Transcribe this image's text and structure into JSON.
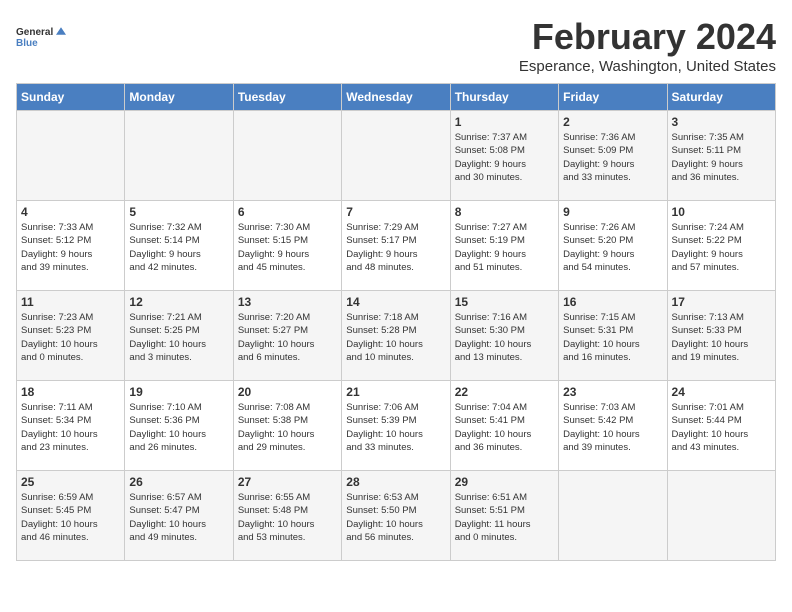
{
  "header": {
    "logo_line1": "General",
    "logo_line2": "Blue",
    "month": "February 2024",
    "location": "Esperance, Washington, United States"
  },
  "days_header": [
    "Sunday",
    "Monday",
    "Tuesday",
    "Wednesday",
    "Thursday",
    "Friday",
    "Saturday"
  ],
  "weeks": [
    [
      {
        "num": "",
        "info": ""
      },
      {
        "num": "",
        "info": ""
      },
      {
        "num": "",
        "info": ""
      },
      {
        "num": "",
        "info": ""
      },
      {
        "num": "1",
        "info": "Sunrise: 7:37 AM\nSunset: 5:08 PM\nDaylight: 9 hours\nand 30 minutes."
      },
      {
        "num": "2",
        "info": "Sunrise: 7:36 AM\nSunset: 5:09 PM\nDaylight: 9 hours\nand 33 minutes."
      },
      {
        "num": "3",
        "info": "Sunrise: 7:35 AM\nSunset: 5:11 PM\nDaylight: 9 hours\nand 36 minutes."
      }
    ],
    [
      {
        "num": "4",
        "info": "Sunrise: 7:33 AM\nSunset: 5:12 PM\nDaylight: 9 hours\nand 39 minutes."
      },
      {
        "num": "5",
        "info": "Sunrise: 7:32 AM\nSunset: 5:14 PM\nDaylight: 9 hours\nand 42 minutes."
      },
      {
        "num": "6",
        "info": "Sunrise: 7:30 AM\nSunset: 5:15 PM\nDaylight: 9 hours\nand 45 minutes."
      },
      {
        "num": "7",
        "info": "Sunrise: 7:29 AM\nSunset: 5:17 PM\nDaylight: 9 hours\nand 48 minutes."
      },
      {
        "num": "8",
        "info": "Sunrise: 7:27 AM\nSunset: 5:19 PM\nDaylight: 9 hours\nand 51 minutes."
      },
      {
        "num": "9",
        "info": "Sunrise: 7:26 AM\nSunset: 5:20 PM\nDaylight: 9 hours\nand 54 minutes."
      },
      {
        "num": "10",
        "info": "Sunrise: 7:24 AM\nSunset: 5:22 PM\nDaylight: 9 hours\nand 57 minutes."
      }
    ],
    [
      {
        "num": "11",
        "info": "Sunrise: 7:23 AM\nSunset: 5:23 PM\nDaylight: 10 hours\nand 0 minutes."
      },
      {
        "num": "12",
        "info": "Sunrise: 7:21 AM\nSunset: 5:25 PM\nDaylight: 10 hours\nand 3 minutes."
      },
      {
        "num": "13",
        "info": "Sunrise: 7:20 AM\nSunset: 5:27 PM\nDaylight: 10 hours\nand 6 minutes."
      },
      {
        "num": "14",
        "info": "Sunrise: 7:18 AM\nSunset: 5:28 PM\nDaylight: 10 hours\nand 10 minutes."
      },
      {
        "num": "15",
        "info": "Sunrise: 7:16 AM\nSunset: 5:30 PM\nDaylight: 10 hours\nand 13 minutes."
      },
      {
        "num": "16",
        "info": "Sunrise: 7:15 AM\nSunset: 5:31 PM\nDaylight: 10 hours\nand 16 minutes."
      },
      {
        "num": "17",
        "info": "Sunrise: 7:13 AM\nSunset: 5:33 PM\nDaylight: 10 hours\nand 19 minutes."
      }
    ],
    [
      {
        "num": "18",
        "info": "Sunrise: 7:11 AM\nSunset: 5:34 PM\nDaylight: 10 hours\nand 23 minutes."
      },
      {
        "num": "19",
        "info": "Sunrise: 7:10 AM\nSunset: 5:36 PM\nDaylight: 10 hours\nand 26 minutes."
      },
      {
        "num": "20",
        "info": "Sunrise: 7:08 AM\nSunset: 5:38 PM\nDaylight: 10 hours\nand 29 minutes."
      },
      {
        "num": "21",
        "info": "Sunrise: 7:06 AM\nSunset: 5:39 PM\nDaylight: 10 hours\nand 33 minutes."
      },
      {
        "num": "22",
        "info": "Sunrise: 7:04 AM\nSunset: 5:41 PM\nDaylight: 10 hours\nand 36 minutes."
      },
      {
        "num": "23",
        "info": "Sunrise: 7:03 AM\nSunset: 5:42 PM\nDaylight: 10 hours\nand 39 minutes."
      },
      {
        "num": "24",
        "info": "Sunrise: 7:01 AM\nSunset: 5:44 PM\nDaylight: 10 hours\nand 43 minutes."
      }
    ],
    [
      {
        "num": "25",
        "info": "Sunrise: 6:59 AM\nSunset: 5:45 PM\nDaylight: 10 hours\nand 46 minutes."
      },
      {
        "num": "26",
        "info": "Sunrise: 6:57 AM\nSunset: 5:47 PM\nDaylight: 10 hours\nand 49 minutes."
      },
      {
        "num": "27",
        "info": "Sunrise: 6:55 AM\nSunset: 5:48 PM\nDaylight: 10 hours\nand 53 minutes."
      },
      {
        "num": "28",
        "info": "Sunrise: 6:53 AM\nSunset: 5:50 PM\nDaylight: 10 hours\nand 56 minutes."
      },
      {
        "num": "29",
        "info": "Sunrise: 6:51 AM\nSunset: 5:51 PM\nDaylight: 11 hours\nand 0 minutes."
      },
      {
        "num": "",
        "info": ""
      },
      {
        "num": "",
        "info": ""
      }
    ]
  ]
}
